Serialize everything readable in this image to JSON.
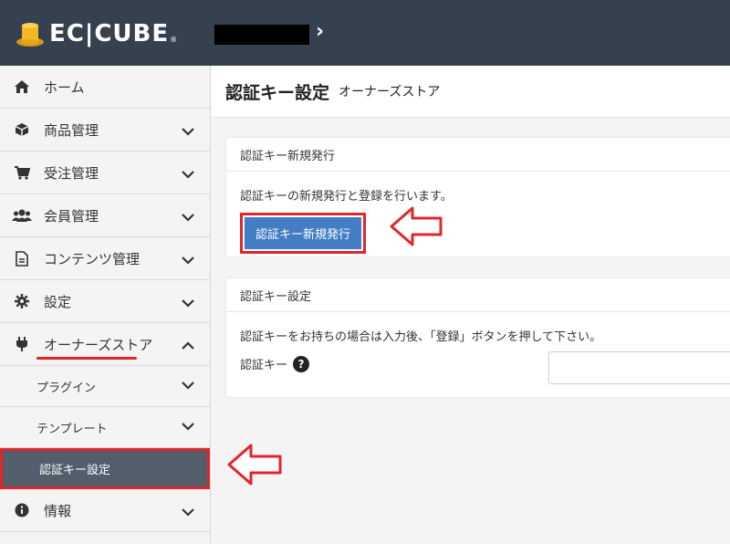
{
  "header": {
    "logo_text": "EC|CUBE",
    "reg_mark": "®"
  },
  "sidebar": {
    "items": [
      {
        "label": "ホーム",
        "icon": "home-icon"
      },
      {
        "label": "商品管理",
        "icon": "cube-icon"
      },
      {
        "label": "受注管理",
        "icon": "cart-icon"
      },
      {
        "label": "会員管理",
        "icon": "users-icon"
      },
      {
        "label": "コンテンツ管理",
        "icon": "document-icon"
      },
      {
        "label": "設定",
        "icon": "gear-icon"
      },
      {
        "label": "オーナーズストア",
        "icon": "plug-icon"
      },
      {
        "label": "情報",
        "icon": "info-icon"
      }
    ],
    "subitems": [
      {
        "label": "プラグイン"
      },
      {
        "label": "テンプレート"
      },
      {
        "label": "認証キー設定"
      }
    ]
  },
  "main": {
    "title": "認証キー設定",
    "subtitle": "オーナーズストア",
    "card1": {
      "header": "認証キー新規発行",
      "text": "認証キーの新規発行と登録を行います。",
      "button": "認証キー新規発行"
    },
    "card2": {
      "header": "認証キー設定",
      "text": "認証キーをお持ちの場合は入力後、「登録」ボタンを押して下さい。",
      "field_label": "認証キー",
      "help": "?"
    }
  },
  "colors": {
    "header_bg": "#364150",
    "accent_red": "#e0262c",
    "button_blue": "#437ec4",
    "active_bg": "#525e6c"
  }
}
